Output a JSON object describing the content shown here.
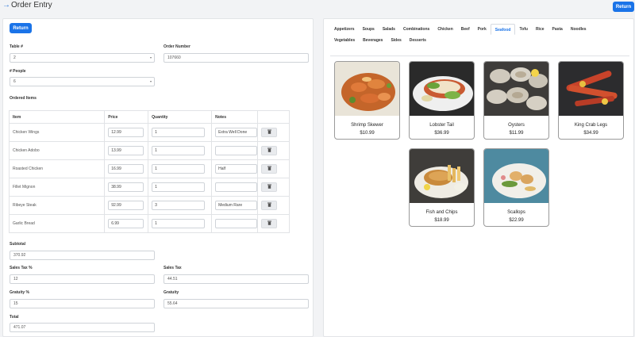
{
  "header": {
    "title": "Order Entry",
    "return_label": "Return"
  },
  "order": {
    "return_label": "Return",
    "table_label": "Table #",
    "table_value": "2",
    "order_number_label": "Order Number",
    "order_number_value": "107660",
    "people_label": "# People",
    "people_value": "6",
    "ordered_items_label": "Ordered Items"
  },
  "items_table": {
    "headers": [
      "Item",
      "Price",
      "Quantity",
      "Notes"
    ],
    "rows": [
      {
        "item": "Chicken Wings",
        "price": "12.99",
        "quantity": "1",
        "notes": "Extra Well Done"
      },
      {
        "item": "Chicken Adobo",
        "price": "13.99",
        "quantity": "1",
        "notes": ""
      },
      {
        "item": "Roasted Chicken",
        "price": "16.99",
        "quantity": "1",
        "notes": "Half"
      },
      {
        "item": "Fillet Mignon",
        "price": "38.99",
        "quantity": "1",
        "notes": ""
      },
      {
        "item": "Ribeye Steak",
        "price": "92.99",
        "quantity": "3",
        "notes": "Medium Rare"
      },
      {
        "item": "Garlic Bread",
        "price": "6.99",
        "quantity": "1",
        "notes": ""
      }
    ]
  },
  "totals": {
    "subtotal_label": "Subtotal",
    "subtotal_value": "370.92",
    "sales_tax_pct_label": "Sales Tax %",
    "sales_tax_pct_value": "12",
    "sales_tax_label": "Sales Tax",
    "sales_tax_value": "44.51",
    "gratuity_pct_label": "Gratuity %",
    "gratuity_pct_value": "15",
    "gratuity_label": "Gratuity",
    "gratuity_value": "55.64",
    "total_label": "Total",
    "total_value": "471.07"
  },
  "menu": {
    "tabs_row1": [
      "Appetizers",
      "Soups",
      "Salads",
      "Combinations",
      "Chicken",
      "Beef",
      "Pork",
      "Seafood",
      "Tofu",
      "Rice",
      "Pasta",
      "Noodles"
    ],
    "tabs_row2": [
      "Vegetables",
      "Beverages",
      "Sides",
      "Desserts"
    ],
    "active_tab": "Seafood",
    "cards": [
      {
        "name": "Shrimp Skewer",
        "price": "$10.99"
      },
      {
        "name": "Lobster Tail",
        "price": "$36.99"
      },
      {
        "name": "Oysters",
        "price": "$11.99"
      },
      {
        "name": "King Crab Legs",
        "price": "$34.99"
      },
      {
        "name": "Fish and Chips",
        "price": "$18.99"
      },
      {
        "name": "Scallops",
        "price": "$22.99"
      }
    ]
  },
  "colors": {
    "accent": "#1a73e8"
  }
}
